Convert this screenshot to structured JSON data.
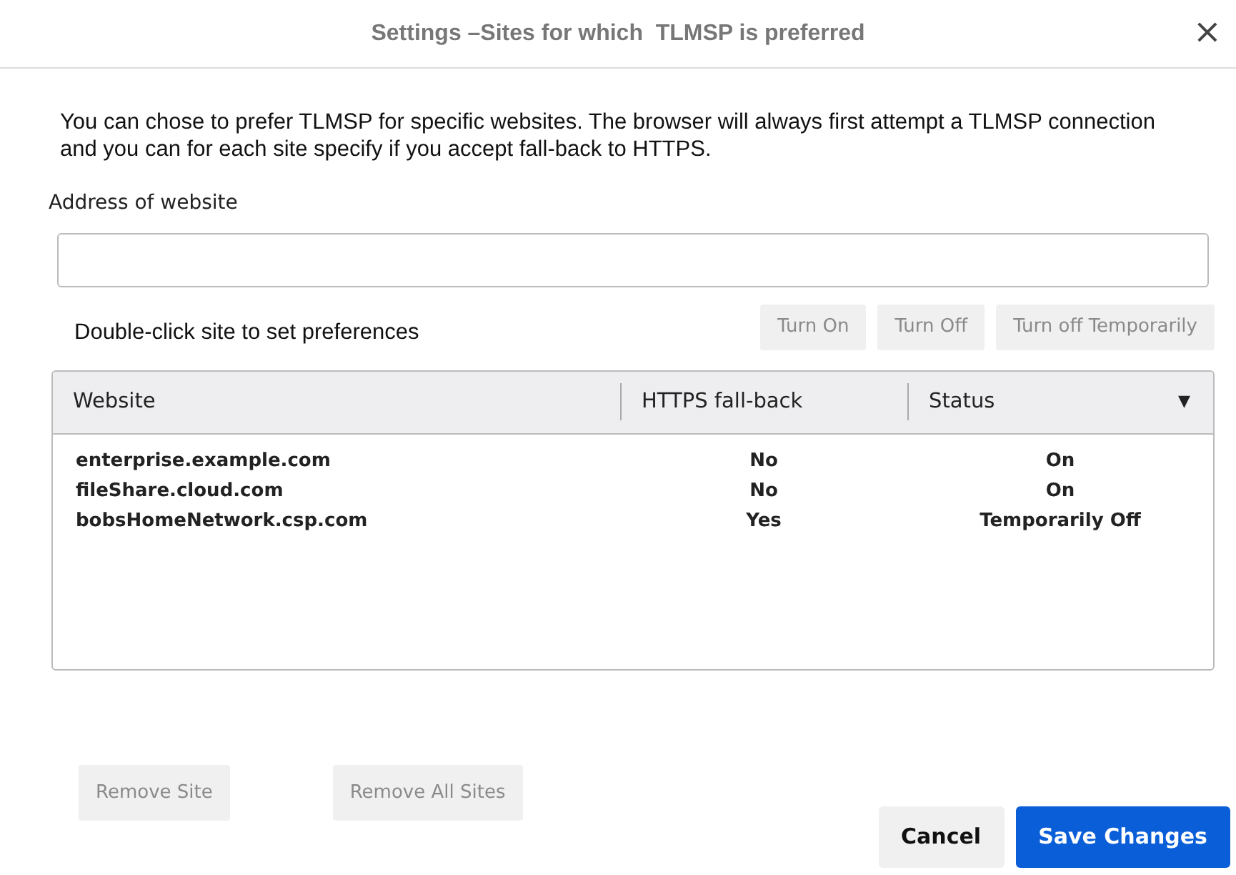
{
  "window": {
    "title": "Settings –Sites for which  TLMSP is preferred",
    "close": "×"
  },
  "description": "You can chose to prefer TLMSP for specific websites. The browser will always first attempt a TLMSP connection and you can for each site specify if you accept fall-back to HTTPS.",
  "address": {
    "label": "Address of website"
  },
  "site_buttons": [
    {
      "label": "Turn On",
      "disabled": true
    },
    {
      "label": "Turn Off",
      "disabled": true
    },
    {
      "label": "Turn off Temporarily",
      "disabled": true
    }
  ],
  "hint": "Double-click site to set preferences",
  "table": {
    "columns": [
      "Website",
      "HTTPS fall-back",
      "Status"
    ],
    "sort_caret": "▼",
    "rows": [
      [
        "enterprise.example.com",
        "No",
        "On"
      ],
      [
        "fileShare.cloud.com",
        "No",
        "On"
      ],
      [
        "bobsHomeNetwork.csp.com",
        "Yes",
        "Temporarily Off"
      ]
    ]
  },
  "remove_buttons": [
    {
      "label": "Remove Site",
      "disabled": true
    },
    {
      "label": "Remove All Sites",
      "disabled": true
    }
  ],
  "footer_buttons": [
    {
      "label": "Cancel",
      "kind": "secondary"
    },
    {
      "label": "Save Changes",
      "kind": "primary"
    }
  ]
}
